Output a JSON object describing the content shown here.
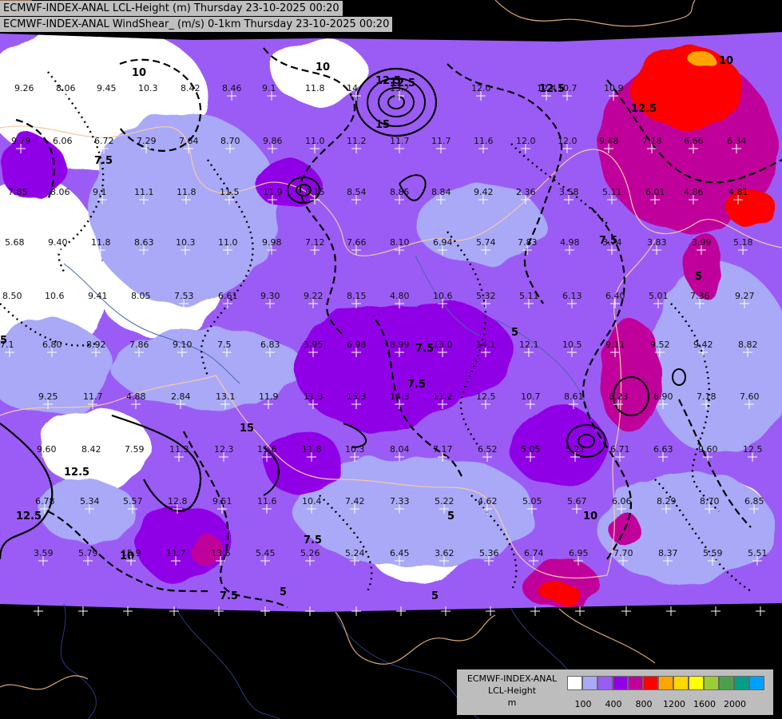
{
  "header": {
    "line1": "ECMWF-INDEX-ANAL LCL-Height (m) Thursday 23-10-2025 00:20",
    "line2": "ECMWF-INDEX-ANAL WindShear_ (m/s) 0-1km Thursday 23-10-2025 00:20"
  },
  "legend": {
    "title1": "ECMWF-INDEX-ANAL",
    "title2": "LCL-Height",
    "unit": "m",
    "colors": [
      "#ffffff",
      "#a9a9f7",
      "#9b5cf5",
      "#9000e6",
      "#c0009a",
      "#ff0000",
      "#ffa500",
      "#ffd700",
      "#ffff00",
      "#9acd32",
      "#4ca04c",
      "#00a088",
      "#00a0ff"
    ],
    "ticks": [
      "100",
      "400",
      "800",
      "1200",
      "1600",
      "2000"
    ]
  },
  "map": {
    "contour_labels": [
      "10",
      "12.5",
      "7.5",
      "10",
      "12.5",
      "15",
      "12.5",
      "7.5",
      "5",
      "12.5",
      "10",
      "7.5",
      "5",
      "5",
      "7.5",
      "5",
      "10",
      "15",
      "12.5",
      "12.5",
      "10",
      "7.5",
      "5",
      "7.5",
      "5"
    ],
    "station_values": [
      "9.26",
      "8.06",
      "9.45",
      "10.3",
      "8.42",
      "8.46",
      "9.1",
      "11.8",
      "14",
      "13.2",
      "12.0",
      "12.4",
      "10.7",
      "10.9",
      "9.79",
      "6.06",
      "6.72",
      "7.29",
      "7.64",
      "8.70",
      "9.86",
      "11.0",
      "11.2",
      "11.7",
      "11.7",
      "11.6",
      "12.0",
      "12.0",
      "9.48",
      "7.18",
      "6.66",
      "6.34",
      "7.85",
      "8.06",
      "9.1",
      "11.1",
      "11.8",
      "11.5",
      "11.9",
      "9.15",
      "8.54",
      "8.85",
      "8.84",
      "9.42",
      "2.36",
      "3.58",
      "5.11",
      "6.01",
      "4.86",
      "4.81",
      "5.68",
      "9.40",
      "11.8",
      "8.63",
      "10.3",
      "11.0",
      "9.98",
      "7.12",
      "7.66",
      "8.10",
      "6.94",
      "5.74",
      "7.83",
      "4.98",
      "3.74",
      "3.83",
      "3.99",
      "5.18",
      "8.50",
      "10.6",
      "9.41",
      "8.05",
      "7.53",
      "6.61",
      "9.30",
      "9.22",
      "8.15",
      "4.80",
      "10.6",
      "5.32",
      "5.11",
      "6.13",
      "6.40",
      "5.01",
      "7.36",
      "9.27",
      "7.1",
      "6.80",
      "8.92",
      "7.86",
      "9.10",
      "7.5",
      "6.83",
      "3.95",
      "6.98",
      "8.99",
      "13.0",
      "14.1",
      "12.1",
      "10.5",
      "9.11",
      "9.52",
      "9.42",
      "8.82",
      "9.25",
      "11.7",
      "4.88",
      "2.84",
      "13.1",
      "11.9",
      "11.3",
      "15.3",
      "14.3",
      "11.2",
      "12.5",
      "10.7",
      "8.61",
      "8.23",
      "6.90",
      "7.18",
      "7.60",
      "9.60",
      "8.42",
      "7.59",
      "11.3",
      "12.3",
      "11.6",
      "11.8",
      "10.3",
      "8.04",
      "7.17",
      "6.52",
      "5.05",
      "5.21",
      "6.71",
      "6.63",
      "9.60",
      "12.5",
      "6.78",
      "5.34",
      "5.57",
      "12.8",
      "9.51",
      "11.6",
      "10.4",
      "7.42",
      "7.33",
      "5.22",
      "4.62",
      "5.05",
      "5.67",
      "6.06",
      "8.29",
      "8.70",
      "6.85",
      "3.59",
      "5.79",
      "15.9",
      "11.7",
      "13.6",
      "5.45",
      "5.26",
      "5.24",
      "6.45",
      "3.62",
      "5.36",
      "6.74",
      "6.95",
      "7.70",
      "8.37",
      "5.59",
      "5.51"
    ]
  }
}
